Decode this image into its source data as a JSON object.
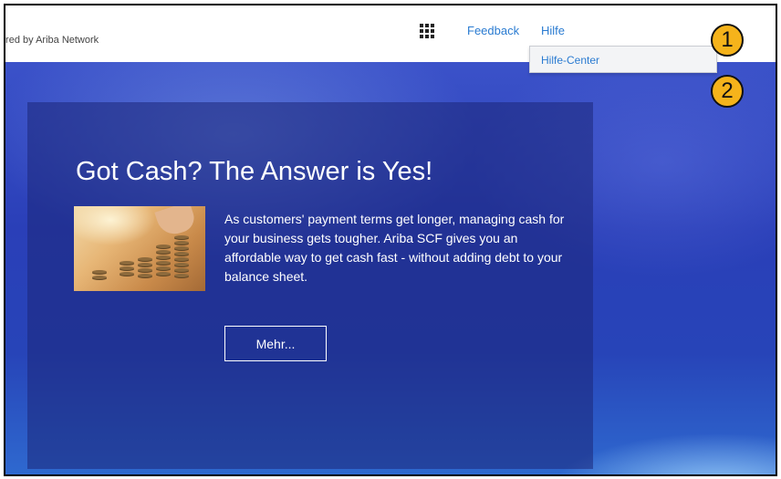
{
  "topbar": {
    "powered_by": "wered by Ariba Network",
    "apps_icon": "grid-icon",
    "feedback_label": "Feedback",
    "help_label": "Hilfe"
  },
  "help_menu": {
    "items": [
      {
        "label": "Hilfe-Center"
      }
    ]
  },
  "hero": {
    "headline": "Got Cash? The Answer is Yes!",
    "image": "coin-stack-photo",
    "body": "As customers' payment terms get longer, managing cash for your business gets tougher. Ariba SCF gives you an affordable way to get cash fast - without adding debt to your balance sheet.",
    "button_label": "Mehr..."
  },
  "annotations": [
    {
      "label": "1"
    },
    {
      "label": "2"
    }
  ],
  "colors": {
    "link": "#2a7bd1",
    "marker": "#f5b31b",
    "hero_blue": "#2a3fb8"
  }
}
